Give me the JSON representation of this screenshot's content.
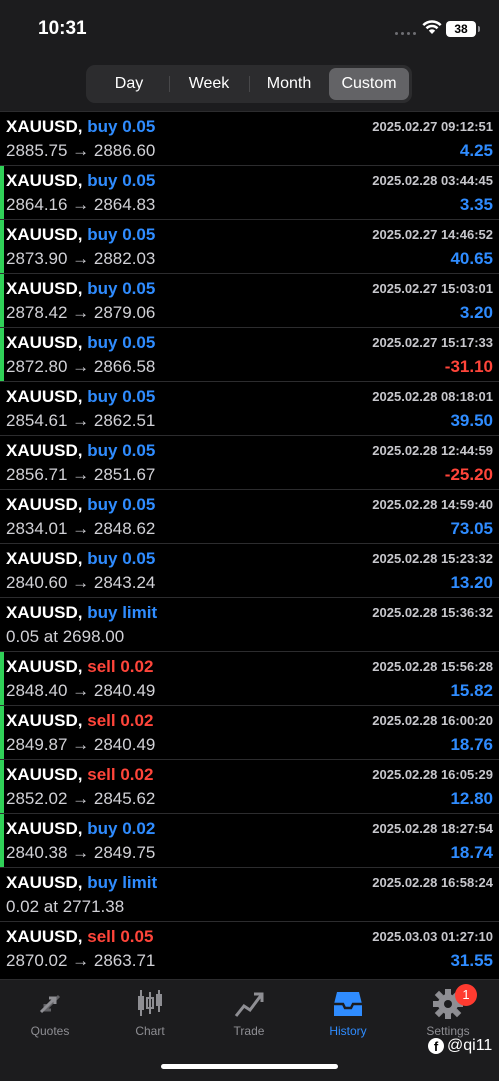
{
  "status": {
    "time": "10:31",
    "battery": "38"
  },
  "periods": [
    "Day",
    "Week",
    "Month",
    "Custom"
  ],
  "active_period": "Custom",
  "trades": [
    {
      "symbol": "XAUUSD,",
      "side": "buy",
      "detail": "buy 0.05",
      "time": "2025.02.27 09:12:51",
      "prices": "2885.75 → 2886.60",
      "profit": "4.25",
      "marker": false
    },
    {
      "symbol": "XAUUSD,",
      "side": "buy",
      "detail": "buy 0.05",
      "time": "2025.02.28 03:44:45",
      "prices": "2864.16 → 2864.83",
      "profit": "3.35",
      "marker": true
    },
    {
      "symbol": "XAUUSD,",
      "side": "buy",
      "detail": "buy 0.05",
      "time": "2025.02.27 14:46:52",
      "prices": "2873.90 → 2882.03",
      "profit": "40.65",
      "marker": true
    },
    {
      "symbol": "XAUUSD,",
      "side": "buy",
      "detail": "buy 0.05",
      "time": "2025.02.27 15:03:01",
      "prices": "2878.42 → 2879.06",
      "profit": "3.20",
      "marker": true
    },
    {
      "symbol": "XAUUSD,",
      "side": "buy",
      "detail": "buy 0.05",
      "time": "2025.02.27 15:17:33",
      "prices": "2872.80 → 2866.58",
      "profit": "-31.10",
      "marker": true
    },
    {
      "symbol": "XAUUSD,",
      "side": "buy",
      "detail": "buy 0.05",
      "time": "2025.02.28 08:18:01",
      "prices": "2854.61 → 2862.51",
      "profit": "39.50",
      "marker": false
    },
    {
      "symbol": "XAUUSD,",
      "side": "buy",
      "detail": "buy 0.05",
      "time": "2025.02.28 12:44:59",
      "prices": "2856.71 → 2851.67",
      "profit": "-25.20",
      "marker": false
    },
    {
      "symbol": "XAUUSD,",
      "side": "buy",
      "detail": "buy 0.05",
      "time": "2025.02.28 14:59:40",
      "prices": "2834.01 → 2848.62",
      "profit": "73.05",
      "marker": false
    },
    {
      "symbol": "XAUUSD,",
      "side": "buy",
      "detail": "buy 0.05",
      "time": "2025.02.28 15:23:32",
      "prices": "2840.60 → 2843.24",
      "profit": "13.20",
      "marker": false
    },
    {
      "symbol": "XAUUSD,",
      "side": "buy",
      "detail": "buy limit",
      "time": "2025.02.28 15:36:32",
      "prices": "0.05 at 2698.00",
      "profit": "",
      "marker": false
    },
    {
      "symbol": "XAUUSD,",
      "side": "sell",
      "detail": "sell 0.02",
      "time": "2025.02.28 15:56:28",
      "prices": "2848.40 → 2840.49",
      "profit": "15.82",
      "marker": true
    },
    {
      "symbol": "XAUUSD,",
      "side": "sell",
      "detail": "sell 0.02",
      "time": "2025.02.28 16:00:20",
      "prices": "2849.87 → 2840.49",
      "profit": "18.76",
      "marker": true
    },
    {
      "symbol": "XAUUSD,",
      "side": "sell",
      "detail": "sell 0.02",
      "time": "2025.02.28 16:05:29",
      "prices": "2852.02 → 2845.62",
      "profit": "12.80",
      "marker": true
    },
    {
      "symbol": "XAUUSD,",
      "side": "buy",
      "detail": "buy 0.02",
      "time": "2025.02.28 18:27:54",
      "prices": "2840.38 → 2849.75",
      "profit": "18.74",
      "marker": true
    },
    {
      "symbol": "XAUUSD,",
      "side": "buy",
      "detail": "buy limit",
      "time": "2025.02.28 16:58:24",
      "prices": "0.02 at 2771.38",
      "profit": "",
      "marker": false
    },
    {
      "symbol": "XAUUSD,",
      "side": "sell",
      "detail": "sell 0.05",
      "time": "2025.03.03 01:27:10",
      "prices": "2870.02 → 2863.71",
      "profit": "31.55",
      "marker": false
    }
  ],
  "tabs": [
    {
      "label": "Quotes",
      "icon": "quotes-icon"
    },
    {
      "label": "Chart",
      "icon": "chart-icon"
    },
    {
      "label": "Trade",
      "icon": "trade-icon"
    },
    {
      "label": "History",
      "icon": "history-icon"
    },
    {
      "label": "Settings",
      "icon": "settings-icon"
    }
  ],
  "active_tab": "History",
  "settings_badge": "1",
  "watermark": "@qi11",
  "colors": {
    "buy": "#2f8cff",
    "sell": "#ff453a",
    "positive": "#2f8cff",
    "negative": "#ff453a",
    "marker": "#30d158",
    "active_tab": "#2f8cff"
  }
}
